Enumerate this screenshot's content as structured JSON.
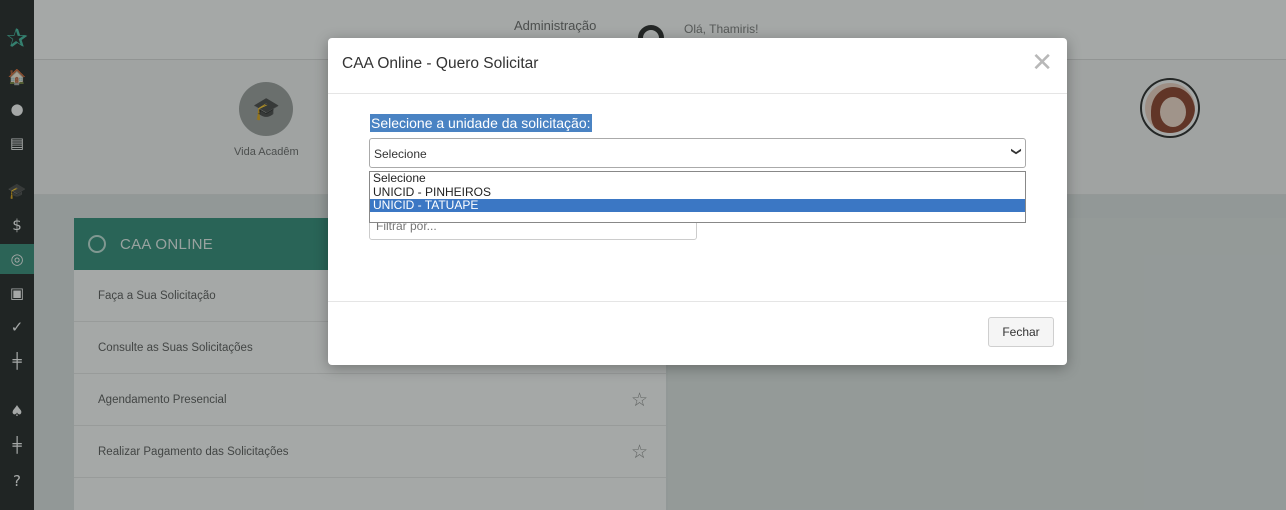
{
  "header": {
    "tab_admin": "Administração",
    "greeting": "Olá, Thamiris!"
  },
  "sidebar": {
    "items": [
      {
        "icon": "home-icon",
        "glyph": "🏠"
      },
      {
        "icon": "user-icon",
        "glyph": "●"
      },
      {
        "icon": "book-icon",
        "glyph": "▤"
      },
      {
        "icon": "graduation-cap-icon",
        "glyph": "🎓"
      },
      {
        "icon": "dollar-icon",
        "glyph": "$"
      },
      {
        "icon": "caa-icon",
        "glyph": "◎"
      },
      {
        "icon": "id-card-icon",
        "glyph": "▣"
      },
      {
        "icon": "check-circle-icon",
        "glyph": "✓"
      },
      {
        "icon": "signpost-icon",
        "glyph": "╪"
      },
      {
        "icon": "bell-icon",
        "glyph": "♠"
      },
      {
        "icon": "signpost-icon",
        "glyph": "╪"
      },
      {
        "icon": "help-icon",
        "glyph": "?"
      }
    ]
  },
  "cards": {
    "vida_label": "Vida Acadêm"
  },
  "panel": {
    "title": "CAA ONLINE",
    "items": [
      "Faça a Sua Solicitação",
      "Consulte as Suas Solicitações",
      "Agendamento Presencial",
      "Realizar Pagamento das Solicitações"
    ]
  },
  "modal": {
    "title": "CAA Online - Quero Solicitar",
    "close_glyph": "✕",
    "unit_label": "Selecione a unidade da solicitação:",
    "select_value": "Selecione",
    "filter_placeholder": "Filtrar por...",
    "close_button": "Fechar"
  },
  "dropdown": {
    "options": [
      "Selecione",
      "UNICID - PINHEIROS",
      "UNICID - TATUAPE"
    ],
    "selected_index": 2
  },
  "colors": {
    "accent": "#2a8a76",
    "highlight": "#3b77c4",
    "sidebar_dark": "#1a1e1e"
  }
}
